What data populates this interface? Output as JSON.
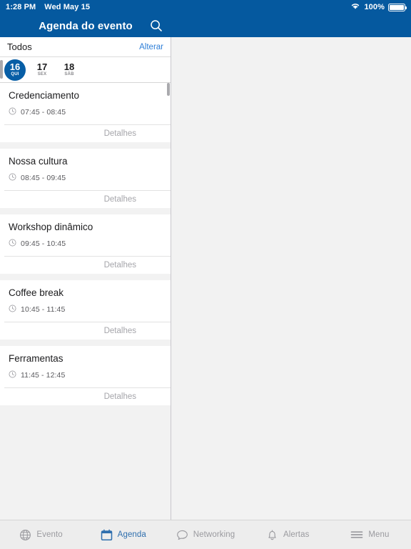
{
  "status_bar": {
    "time": "1:28 PM",
    "date": "Wed May 15",
    "wifi_icon": "wifi-icon",
    "battery_percent": "100%",
    "battery_icon": "battery-icon"
  },
  "nav": {
    "title": "Agenda do evento",
    "search_icon": "search-icon"
  },
  "filter": {
    "label": "Todos",
    "action_label": "Alterar"
  },
  "dates": [
    {
      "day": "16",
      "weekday": "QUI",
      "selected": true
    },
    {
      "day": "17",
      "weekday": "SEX",
      "selected": false
    },
    {
      "day": "18",
      "weekday": "SÁB",
      "selected": false
    }
  ],
  "sessions": [
    {
      "title": "Credenciamento",
      "time": "07:45 - 08:45",
      "clock_icon": "clock-icon",
      "details_label": "Detalhes"
    },
    {
      "title": "Nossa cultura",
      "time": "08:45 - 09:45",
      "clock_icon": "clock-icon",
      "details_label": "Detalhes"
    },
    {
      "title": "Workshop dinâmico",
      "time": "09:45 - 10:45",
      "clock_icon": "clock-icon",
      "details_label": "Detalhes"
    },
    {
      "title": "Coffee break",
      "time": "10:45 - 11:45",
      "clock_icon": "clock-icon",
      "details_label": "Detalhes"
    },
    {
      "title": "Ferramentas",
      "time": "11:45 - 12:45",
      "clock_icon": "clock-icon",
      "details_label": "Detalhes"
    }
  ],
  "tabs": [
    {
      "label": "Evento",
      "icon": "globe-icon",
      "active": false
    },
    {
      "label": "Agenda",
      "icon": "calendar-icon",
      "active": true
    },
    {
      "label": "Networking",
      "icon": "chat-bubble-icon",
      "active": false
    },
    {
      "label": "Alertas",
      "icon": "bell-icon",
      "active": false
    },
    {
      "label": "Menu",
      "icon": "hamburger-icon",
      "active": false
    }
  ],
  "colors": {
    "brand_blue": "#05599f",
    "accent_link": "#2f7fd8",
    "tab_active": "#2f6fae",
    "list_background": "#f2f2f2"
  }
}
